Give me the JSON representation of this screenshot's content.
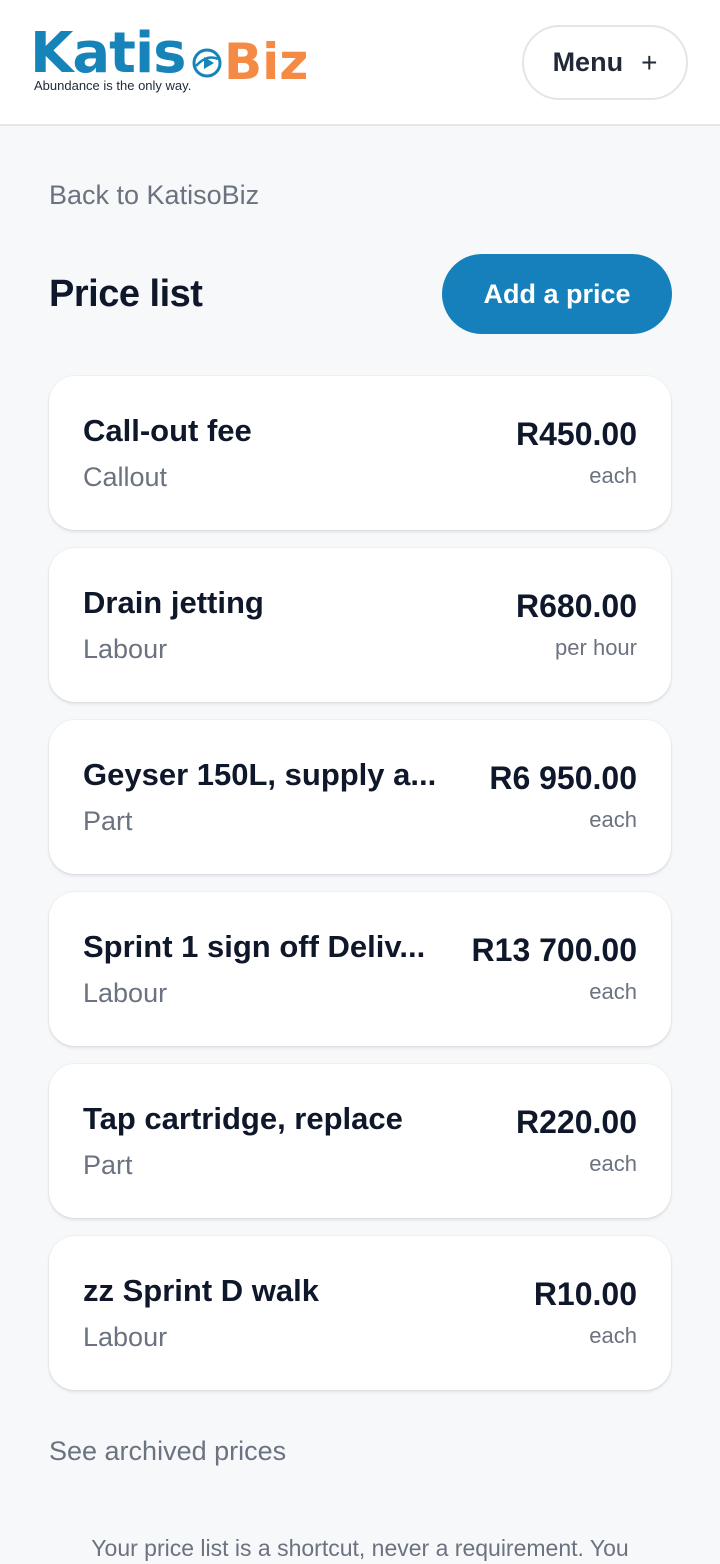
{
  "header": {
    "logo": {
      "part1": "Katis",
      "part2": "Biz",
      "tagline": "Abundance is the only way."
    },
    "menu_label": "Menu",
    "menu_icon": "+"
  },
  "nav": {
    "back_label": "Back to KatisoBiz"
  },
  "page": {
    "title": "Price list",
    "add_button_label": "Add a price"
  },
  "prices": [
    {
      "name": "Call-out fee",
      "category": "Callout",
      "price": "R450.00",
      "unit": "each"
    },
    {
      "name": "Drain jetting",
      "category": "Labour",
      "price": "R680.00",
      "unit": "per hour"
    },
    {
      "name": "Geyser 150L, supply a...",
      "category": "Part",
      "price": "R6 950.00",
      "unit": "each"
    },
    {
      "name": "Sprint 1 sign off Deliv...",
      "category": "Labour",
      "price": "R13 700.00",
      "unit": "each"
    },
    {
      "name": "Tap cartridge, replace",
      "category": "Part",
      "price": "R220.00",
      "unit": "each"
    },
    {
      "name": "zz Sprint D walk",
      "category": "Labour",
      "price": "R10.00",
      "unit": "each"
    }
  ],
  "footer": {
    "archived_label": "See archived prices",
    "note": "Your price list is a shortcut, never a requirement. You"
  },
  "colors": {
    "brand_blue": "#1683b9",
    "brand_orange": "#f58a45",
    "button": "#1580bc"
  }
}
